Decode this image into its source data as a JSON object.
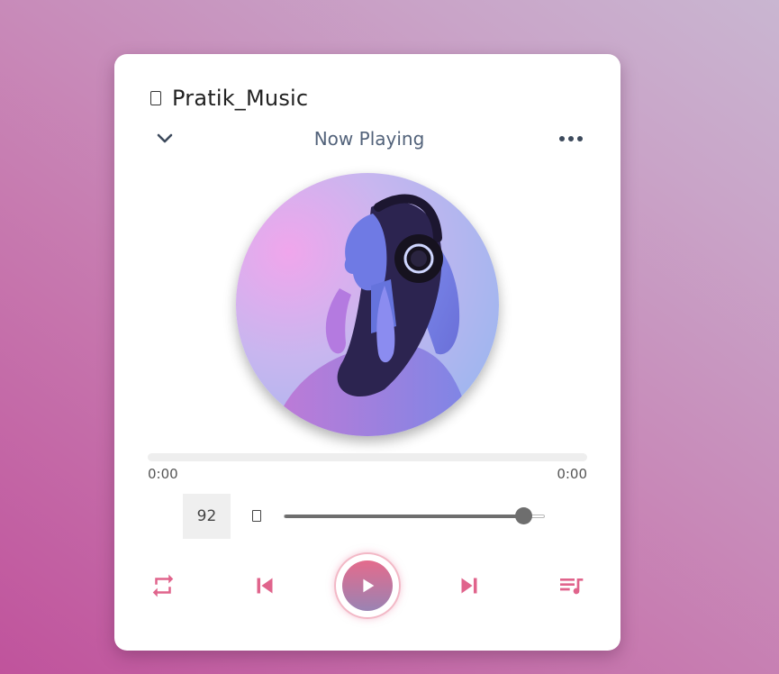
{
  "brand": {
    "title": "Pratik_Music",
    "icon": "music-note-icon"
  },
  "header": {
    "title": "Now Playing",
    "left_icon": "chevron-down-icon",
    "right_icon": "more-horizontal-icon"
  },
  "player": {
    "album_art": "woman-with-headphones",
    "progress_fraction": 0,
    "current_time": "0:00",
    "duration": "0:00"
  },
  "volume": {
    "value": "92",
    "level_fraction": 0.92,
    "icon": "volume-icon"
  },
  "controls": {
    "repeat_icon": "repeat-icon",
    "prev_icon": "skip-previous-icon",
    "play_icon": "play-icon",
    "next_icon": "skip-next-icon",
    "queue_icon": "playlist-icon"
  },
  "colors": {
    "accent": "#e0648c",
    "text_muted": "#52627a",
    "slider": "#6e6e6e"
  }
}
